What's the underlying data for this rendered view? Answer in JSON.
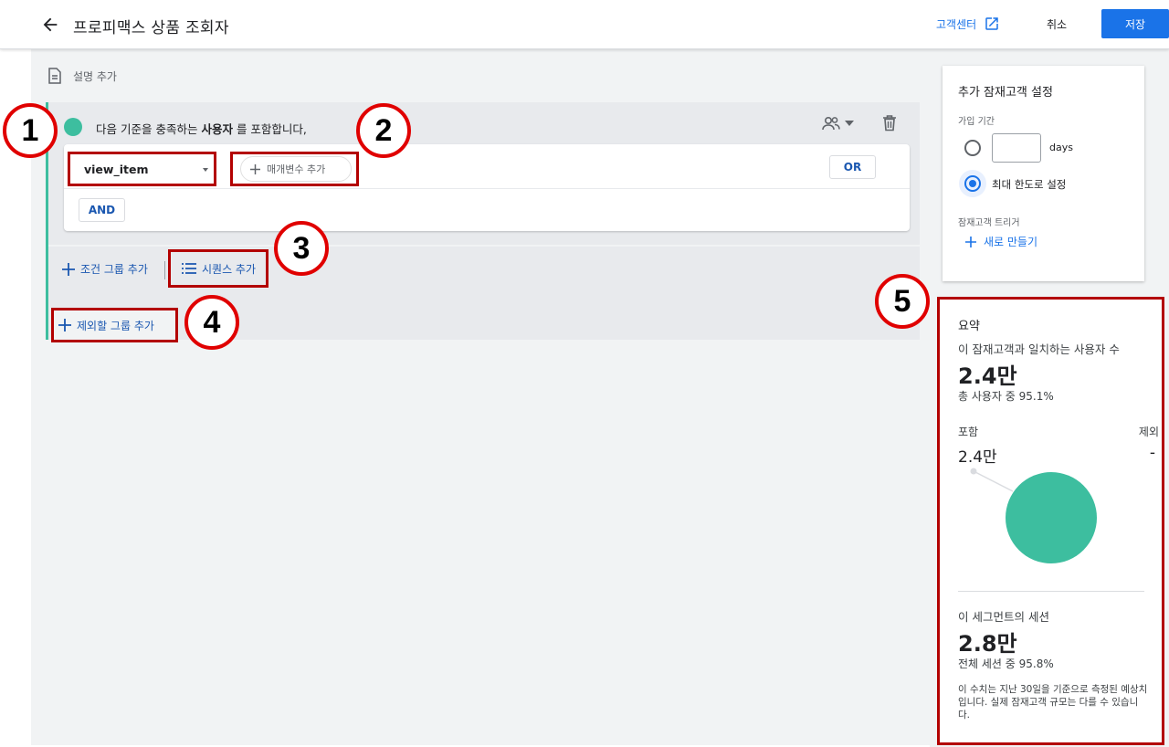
{
  "header": {
    "title": "프로피맥스 상품 조회자",
    "help_label": "고객센터",
    "cancel_label": "취소",
    "save_label": "저장"
  },
  "main": {
    "add_description_label": "설명 추가",
    "condition": {
      "text_prefix": "다음 기준을 충족하는",
      "text_bold": "사용자",
      "text_suffix": "를 포함합니다,",
      "event_value": "view_item",
      "add_param_label": "매개변수 추가",
      "or_label": "OR",
      "and_label": "AND"
    },
    "footer": {
      "add_group_label": "조건 그룹 추가",
      "add_sequence_label": "시퀀스 추가"
    },
    "exclude_label": "제외할 그룹 추가"
  },
  "settings": {
    "title": "추가 잠재고객 설정",
    "period_label": "가입 기간",
    "days_value": "",
    "days_unit": "days",
    "max_label": "최대 한도로 설정",
    "trigger_label": "잠재고객 트리거",
    "new_trigger_label": "새로 만들기"
  },
  "summary": {
    "title": "요약",
    "users_label": "이 잠재고객과 일치하는 사용자 수",
    "users_value": "2.4만",
    "users_pct": "총 사용자 중 95.1%",
    "include_label": "포함",
    "exclude_label": "제외",
    "include_value": "2.4만",
    "exclude_value": "-",
    "sessions_label": "이 세그먼트의 세션",
    "sessions_value": "2.8만",
    "sessions_pct": "전체 세션 중 95.8%",
    "note": "이 수치는 지난 30일을 기준으로 측정된 예상치입니다. 실제 잠재고객 규모는 다를 수 있습니다."
  },
  "annotations": [
    "1",
    "2",
    "3",
    "4",
    "5"
  ],
  "colors": {
    "accent": "#1a73e8",
    "link": "#1a57b0",
    "teal": "#3dbe9f",
    "highlight_box": "#b30000",
    "annotation_circle": "#e00000"
  },
  "icons": {
    "back": "arrow-left-icon",
    "help": "open-in-new-icon",
    "description": "document-icon",
    "scope": "users-icon",
    "delete": "trash-icon",
    "add": "plus-icon",
    "sequence": "list-icon"
  }
}
